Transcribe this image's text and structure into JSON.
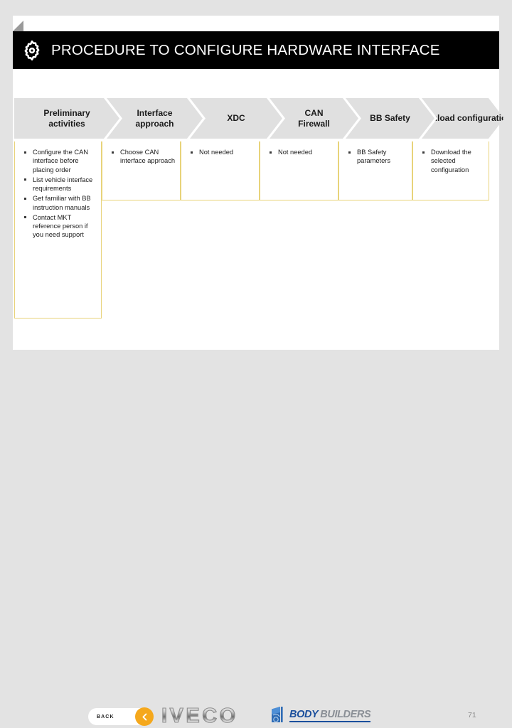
{
  "header": {
    "icon": "gear-icon",
    "title": "PROCEDURE TO CONFIGURE  HARDWARE INTERFACE",
    "background_color": "#000000",
    "text_color": "#ffffff"
  },
  "process_flow": {
    "chevron_color": "#e0e0e0",
    "divider_color": "#e8d37a",
    "steps": [
      {
        "label": "Preliminary\nactivities",
        "bullets": [
          "Configure the CAN interface before placing order",
          "List vehicle interface requirements",
          "Get familiar with BB instruction manuals",
          "Contact MKT reference person if you need support"
        ]
      },
      {
        "label": "Interface\napproach",
        "bullets": [
          "Choose CAN interface approach"
        ]
      },
      {
        "label": "XDC",
        "bullets": [
          "Not needed"
        ]
      },
      {
        "label": "CAN\nFirewall",
        "bullets": [
          "Not needed"
        ]
      },
      {
        "label": "BB Safety",
        "bullets": [
          "BB Safety parameters"
        ]
      },
      {
        "label": "Download\nconfiguration",
        "bullets": [
          "Download the selected configuration"
        ]
      }
    ]
  },
  "footer": {
    "back_label": "BACK",
    "back_icon": "chevron-left-icon",
    "back_accent_color": "#f5a81c",
    "iveco_logo_text": "IVECO",
    "body_builders_logo": {
      "word_one": "BODY",
      "word_two": "BUILDERS",
      "word_one_color": "#1b4f9c",
      "word_two_color": "#8a8f96"
    },
    "page_number": "71"
  }
}
